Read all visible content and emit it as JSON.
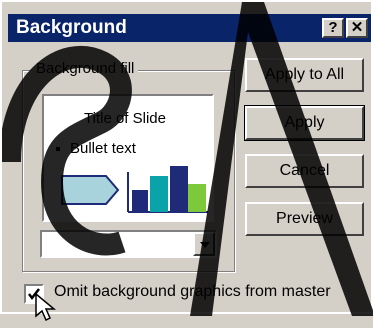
{
  "dialog": {
    "title": "Background",
    "help_button": "?",
    "close_button": "✕"
  },
  "background_fill": {
    "group_label": "Background fill",
    "preview": {
      "slide_title": "Title of Slide",
      "bullet_text": "Bullet text"
    },
    "fill_dropdown": {
      "selected_value": ""
    }
  },
  "buttons": {
    "apply_to_all": "Apply to All",
    "apply": "Apply",
    "cancel": "Cancel",
    "preview": "Preview"
  },
  "omit_checkbox": {
    "label": "Omit background graphics from master",
    "checked": true
  },
  "colors": {
    "titlebar": "#0a246a",
    "face": "#d4d0c8",
    "chart_light_blue": "#a8d3dc",
    "chart_navy": "#1f2a78",
    "chart_teal": "#0aa3a9",
    "chart_green": "#7ec83b"
  }
}
